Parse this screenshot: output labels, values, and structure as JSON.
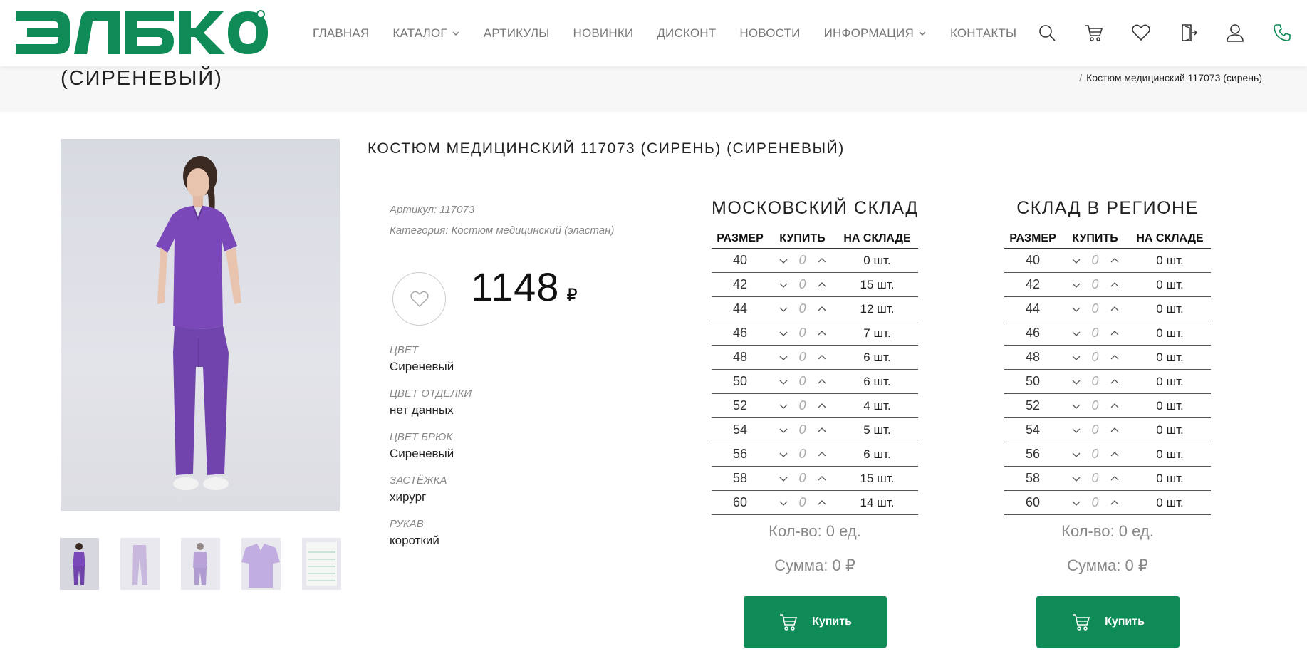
{
  "brand": {
    "name": "ЭЛБКО",
    "color": "#0e8b56"
  },
  "nav": {
    "items": [
      {
        "label": "ГЛАВНАЯ",
        "has_dropdown": false
      },
      {
        "label": "КАТАЛОГ",
        "has_dropdown": true
      },
      {
        "label": "АРТИКУЛЫ",
        "has_dropdown": false
      },
      {
        "label": "НОВИНКИ",
        "has_dropdown": false
      },
      {
        "label": "ДИСКОНТ",
        "has_dropdown": false
      },
      {
        "label": "НОВОСТИ",
        "has_dropdown": false
      },
      {
        "label": "ИНФОРМАЦИЯ",
        "has_dropdown": true
      },
      {
        "label": "КОНТАКТЫ",
        "has_dropdown": false
      }
    ],
    "icons": [
      "search-icon",
      "cart-icon",
      "heart-icon",
      "login-icon",
      "user-icon",
      "phone-icon"
    ]
  },
  "page": {
    "title": "(СИРЕНЕВЫЙ)",
    "breadcrumb_sep": "/",
    "breadcrumb_current": "Костюм медицинский 117073 (сирень)"
  },
  "product": {
    "title": "КОСТЮМ МЕДИЦИНСКИЙ 117073 (СИРЕНЬ) (СИРЕНЕВЫЙ)",
    "article_label": "Артикул:",
    "article_value": "117073",
    "category_label": "Категория:",
    "category_value": "Костюм медицинский (эластан)",
    "price": "1148",
    "currency": "₽",
    "attributes": [
      {
        "label": "ЦВЕТ",
        "value": "Сиреневый"
      },
      {
        "label": "ЦВЕТ ОТДЕЛКИ",
        "value": "нет данных"
      },
      {
        "label": "ЦВЕТ БРЮК",
        "value": "Сиреневый"
      },
      {
        "label": "ЗАСТЁЖКА",
        "value": "хирург"
      },
      {
        "label": "РУКАВ",
        "value": "короткий"
      }
    ],
    "garment_color": "#7a48b8"
  },
  "warehouses": [
    {
      "title": "МОСКОВСКИЙ СКЛАД",
      "headers": {
        "size": "РАЗМЕР",
        "buy": "КУПИТЬ",
        "stock": "НА СКЛАДЕ"
      },
      "rows": [
        {
          "size": "40",
          "qty": "0",
          "stock": "0 шт."
        },
        {
          "size": "42",
          "qty": "0",
          "stock": "15 шт."
        },
        {
          "size": "44",
          "qty": "0",
          "stock": "12 шт."
        },
        {
          "size": "46",
          "qty": "0",
          "stock": "7 шт."
        },
        {
          "size": "48",
          "qty": "0",
          "stock": "6 шт."
        },
        {
          "size": "50",
          "qty": "0",
          "stock": "6 шт."
        },
        {
          "size": "52",
          "qty": "0",
          "stock": "4 шт."
        },
        {
          "size": "54",
          "qty": "0",
          "stock": "5 шт."
        },
        {
          "size": "56",
          "qty": "0",
          "stock": "6 шт."
        },
        {
          "size": "58",
          "qty": "0",
          "stock": "15 шт."
        },
        {
          "size": "60",
          "qty": "0",
          "stock": "14 шт."
        }
      ],
      "total": "Кол-во: 0 ед.",
      "sum": "Сумма: 0 ₽",
      "buy_label": "Купить"
    },
    {
      "title": "СКЛАД В РЕГИОНЕ",
      "headers": {
        "size": "РАЗМЕР",
        "buy": "КУПИТЬ",
        "stock": "НА СКЛАДЕ"
      },
      "rows": [
        {
          "size": "40",
          "qty": "0",
          "stock": "0 шт."
        },
        {
          "size": "42",
          "qty": "0",
          "stock": "0 шт."
        },
        {
          "size": "44",
          "qty": "0",
          "stock": "0 шт."
        },
        {
          "size": "46",
          "qty": "0",
          "stock": "0 шт."
        },
        {
          "size": "48",
          "qty": "0",
          "stock": "0 шт."
        },
        {
          "size": "50",
          "qty": "0",
          "stock": "0 шт."
        },
        {
          "size": "52",
          "qty": "0",
          "stock": "0 шт."
        },
        {
          "size": "54",
          "qty": "0",
          "stock": "0 шт."
        },
        {
          "size": "56",
          "qty": "0",
          "stock": "0 шт."
        },
        {
          "size": "58",
          "qty": "0",
          "stock": "0 шт."
        },
        {
          "size": "60",
          "qty": "0",
          "stock": "0 шт."
        }
      ],
      "total": "Кол-во: 0 ед.",
      "sum": "Сумма: 0 ₽",
      "buy_label": "Купить"
    }
  ]
}
